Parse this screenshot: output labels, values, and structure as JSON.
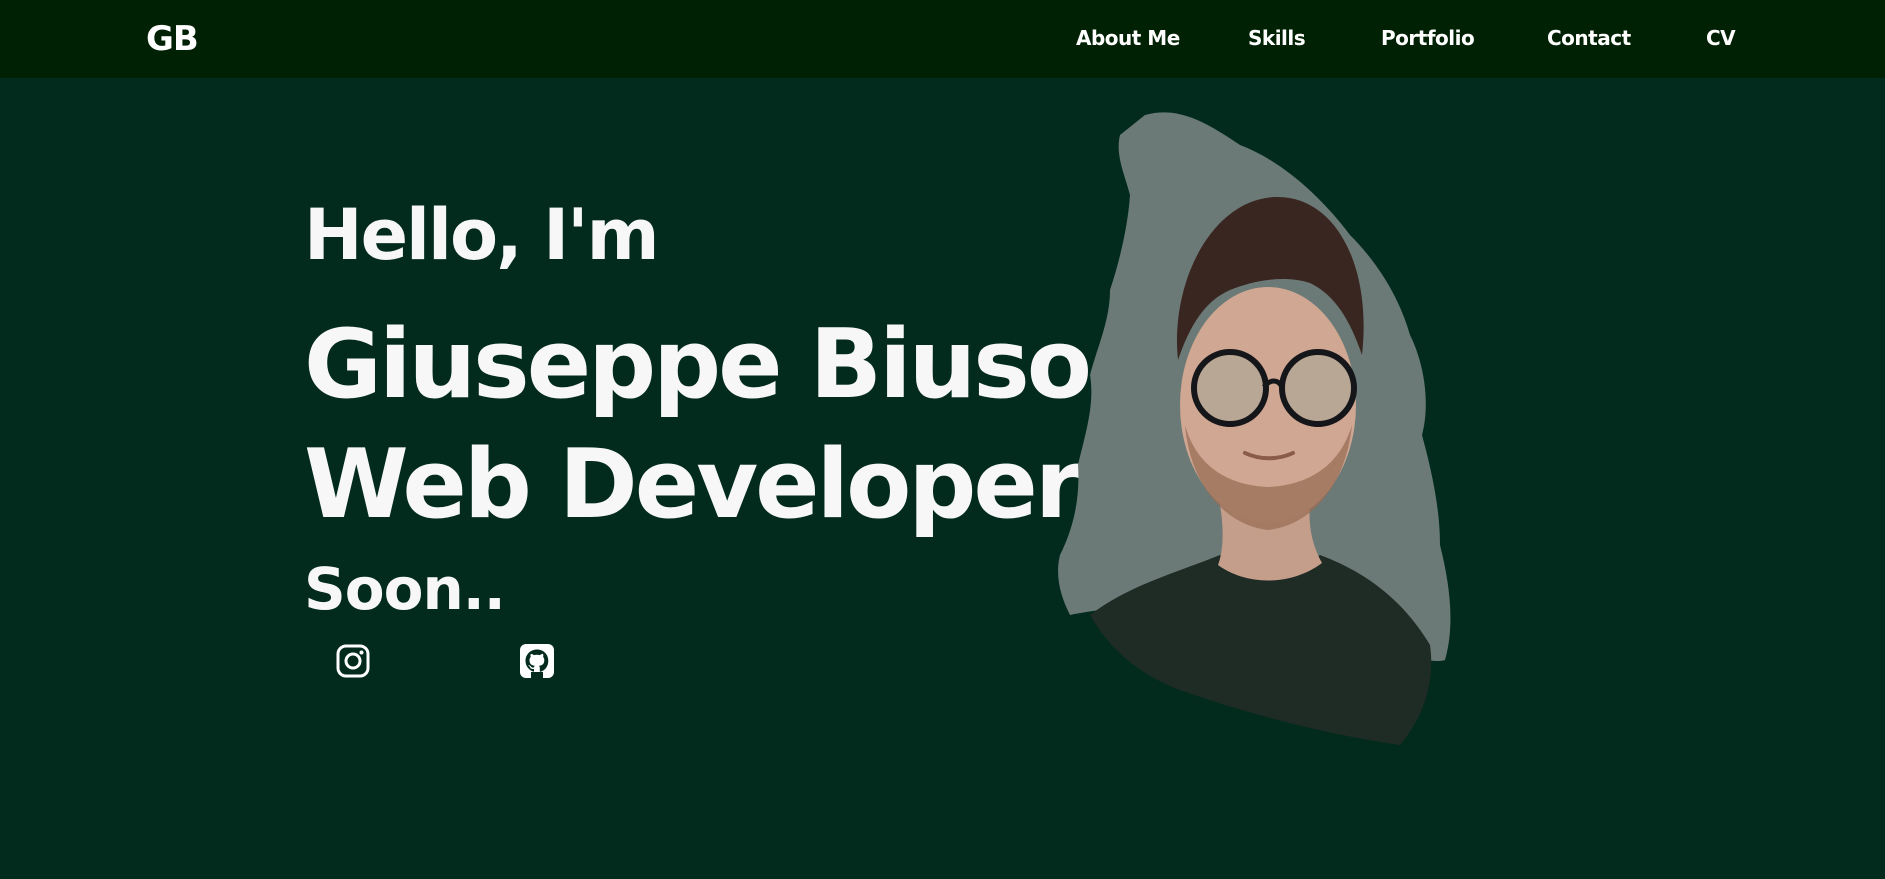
{
  "header": {
    "logo": "GB",
    "nav": [
      {
        "label": "About Me"
      },
      {
        "label": "Skills"
      },
      {
        "label": "Portfolio"
      },
      {
        "label": "Contact"
      },
      {
        "label": "CV"
      }
    ]
  },
  "hero": {
    "greeting": "Hello, I'm",
    "name": "Giuseppe Biuso",
    "role": "Web Developer",
    "status": "Soon.."
  },
  "social": [
    {
      "icon": "instagram-icon"
    },
    {
      "icon": "github-icon"
    }
  ],
  "colors": {
    "navbar": "#012104",
    "background": "#022b1e",
    "text": "#f7f7f7",
    "photo_backdrop": "#6b7a76"
  }
}
